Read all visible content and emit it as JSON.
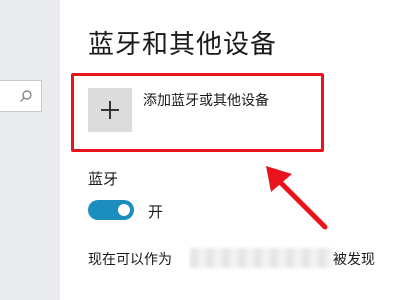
{
  "sidebar": {
    "search_icon": "search-icon"
  },
  "header": {
    "title": "蓝牙和其他设备"
  },
  "add_device": {
    "icon": "plus-icon",
    "label": "添加蓝牙或其他设备"
  },
  "bluetooth": {
    "heading": "蓝牙",
    "toggle_state": true,
    "toggle_label": "开",
    "discoverable_prefix": "现在可以作为",
    "discoverable_suffix": "被发现"
  },
  "annotation": {
    "highlight_color": "#e8131d",
    "arrow_color": "#e8131d"
  },
  "colors": {
    "accent": "#1c8dbf",
    "button_bg": "#dcdcdc",
    "nav_pane": "#e9ebee"
  }
}
